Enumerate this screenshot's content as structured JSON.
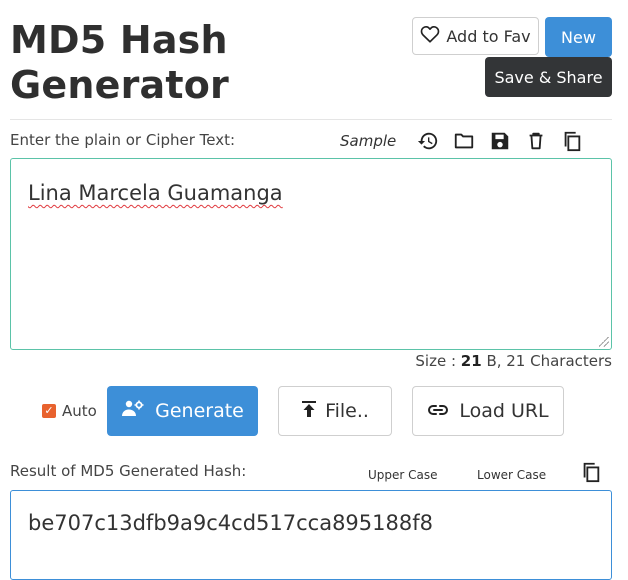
{
  "header": {
    "title": "MD5 Hash Generator",
    "fav_label": "Add to Fav",
    "new_label": "New",
    "save_share_label": "Save & Share"
  },
  "input": {
    "label": "Enter the plain or Cipher Text:",
    "sample_label": "Sample",
    "toolbar_icons": [
      "history-icon",
      "folder-icon",
      "save-icon",
      "trash-icon",
      "copy-icon"
    ],
    "value": "Lina Marcela Guamanga",
    "size_prefix": "Size : ",
    "size_bytes": "21",
    "size_suffix": " B, 21 Characters"
  },
  "actions": {
    "auto_label": "Auto",
    "auto_checked": true,
    "generate_label": "Generate",
    "file_label": "File..",
    "load_url_label": "Load URL"
  },
  "result": {
    "label": "Result of MD5 Generated Hash:",
    "upper_case_label": "Upper Case",
    "lower_case_label": "Lower Case",
    "value": "be707c13dfb9a9c4cd517cca895188f8"
  },
  "colors": {
    "primary": "#3d8fd8",
    "dark": "#333537",
    "input_border": "#5bc3a8",
    "checkbox": "#e8622e"
  }
}
